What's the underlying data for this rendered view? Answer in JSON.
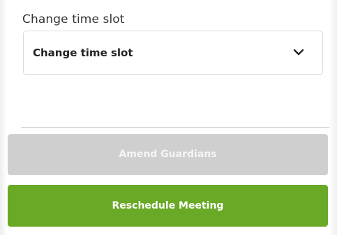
{
  "time_slot": {
    "label": "Change time slot",
    "selected_value": "Change time slot",
    "chevron_icon": "chevron-down-icon"
  },
  "actions": {
    "amend_guardians_label": "Amend Guardians",
    "amend_guardians_state": "disabled",
    "reschedule_label": "Reschedule Meeting"
  },
  "colors": {
    "primary_green": "#69a926",
    "disabled_gray": "#cfcfcf"
  }
}
